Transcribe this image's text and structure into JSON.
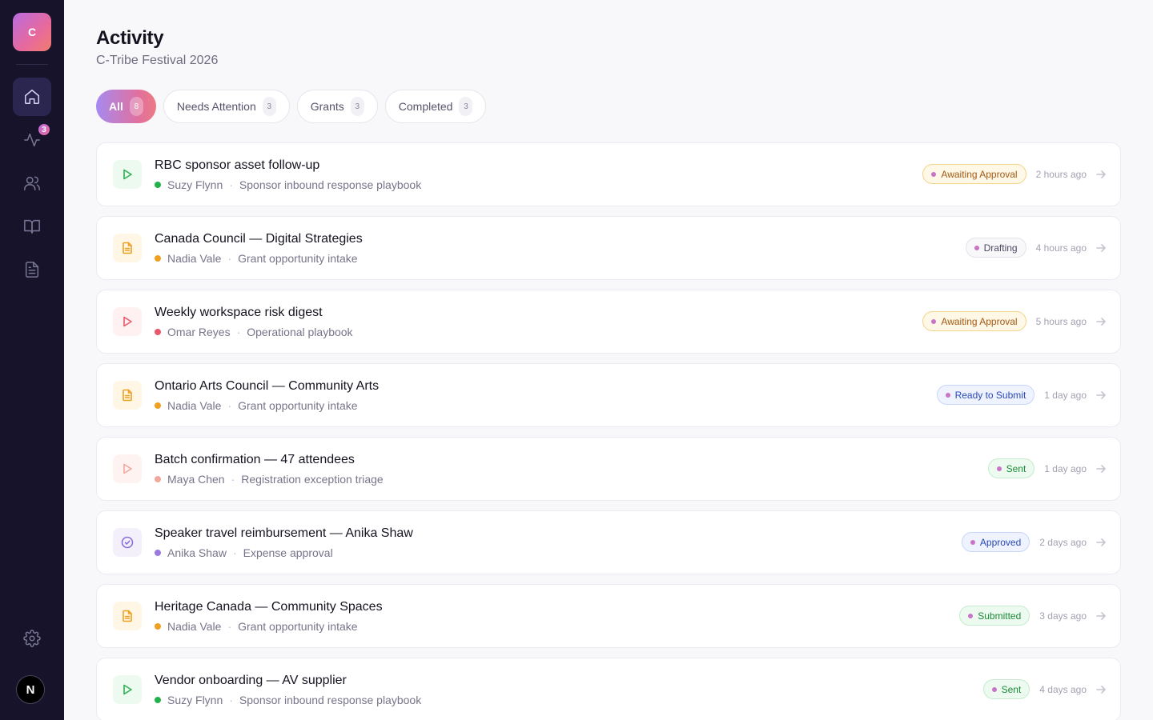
{
  "sidebar": {
    "logo_letter": "C",
    "activity_badge": "3",
    "avatar_letter": "N"
  },
  "header": {
    "title": "Activity",
    "subtitle": "C-Tribe Festival 2026"
  },
  "tabs": [
    {
      "label": "All",
      "count": "8",
      "active": true
    },
    {
      "label": "Needs Attention",
      "count": "3",
      "active": false
    },
    {
      "label": "Grants",
      "count": "3",
      "active": false
    },
    {
      "label": "Completed",
      "count": "3",
      "active": false
    }
  ],
  "activities": [
    {
      "title": "RBC sponsor asset follow-up",
      "person": "Suzy Flynn",
      "playbook": "Sponsor inbound response playbook",
      "status": "Awaiting Approval",
      "time": "2 hours ago",
      "icon": "play-icon",
      "person_color": "#22b24c"
    },
    {
      "title": "Canada Council — Digital Strategies",
      "person": "Nadia Vale",
      "playbook": "Grant opportunity intake",
      "status": "Drafting",
      "time": "4 hours ago",
      "icon": "document-icon",
      "person_color": "#f0a020"
    },
    {
      "title": "Weekly workspace risk digest",
      "person": "Omar Reyes",
      "playbook": "Operational playbook",
      "status": "Awaiting Approval",
      "time": "5 hours ago",
      "icon": "play-icon",
      "person_color": "#e9586a"
    },
    {
      "title": "Ontario Arts Council — Community Arts",
      "person": "Nadia Vale",
      "playbook": "Grant opportunity intake",
      "status": "Ready to Submit",
      "time": "1 day ago",
      "icon": "document-icon",
      "person_color": "#f0a020"
    },
    {
      "title": "Batch confirmation — 47 attendees",
      "person": "Maya Chen",
      "playbook": "Registration exception triage",
      "status": "Sent",
      "time": "1 day ago",
      "icon": "play-icon",
      "person_color": "#f2a79c"
    },
    {
      "title": "Speaker travel reimbursement — Anika Shaw",
      "person": "Anika Shaw",
      "playbook": "Expense approval",
      "status": "Approved",
      "time": "2 days ago",
      "icon": "check-circle-icon",
      "person_color": "#9a7ae0"
    },
    {
      "title": "Heritage Canada — Community Spaces",
      "person": "Nadia Vale",
      "playbook": "Grant opportunity intake",
      "status": "Submitted",
      "time": "3 days ago",
      "icon": "document-icon",
      "person_color": "#f0a020"
    },
    {
      "title": "Vendor onboarding — AV supplier",
      "person": "Suzy Flynn",
      "playbook": "Sponsor inbound response playbook",
      "status": "Sent",
      "time": "4 days ago",
      "icon": "play-icon",
      "person_color": "#22b24c"
    }
  ]
}
